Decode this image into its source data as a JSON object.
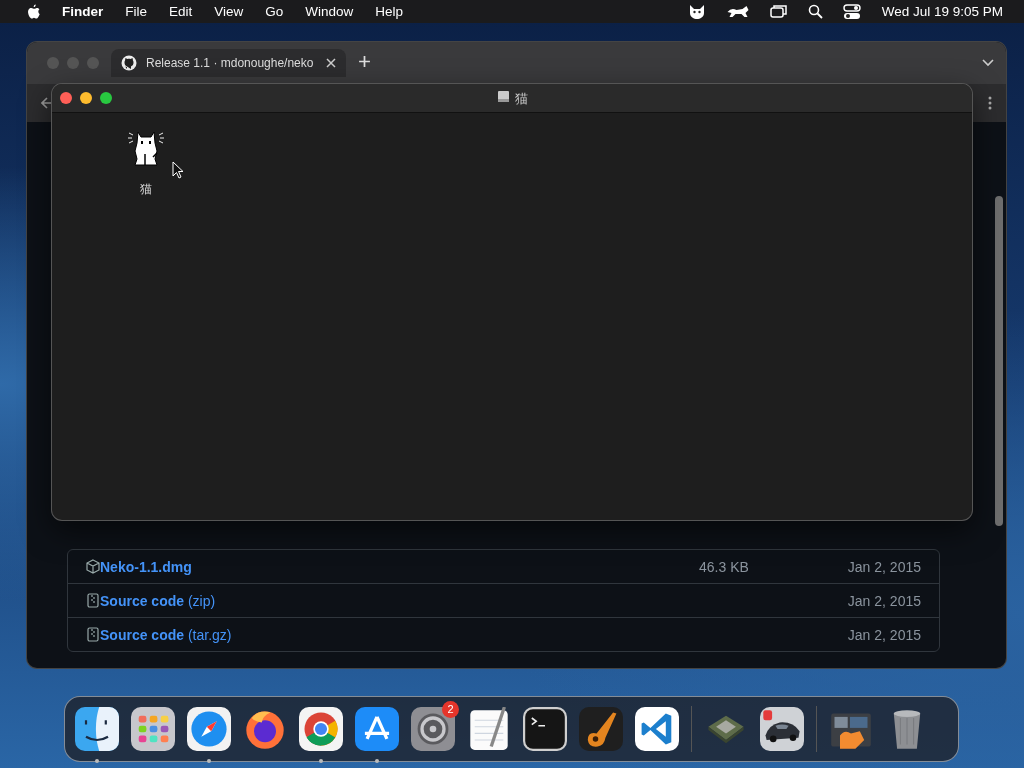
{
  "menu_bar": {
    "app": "Finder",
    "items": [
      "File",
      "Edit",
      "View",
      "Go",
      "Window",
      "Help"
    ],
    "clock": "Wed Jul 19  9:05 PM"
  },
  "browser": {
    "tab": {
      "title": "Release 1.1 · mdonoughe/neko",
      "selected": true
    },
    "assets": [
      {
        "name": "Neko-1.1.dmg",
        "kind": "package",
        "size": "46.3 KB",
        "date": "Jan 2, 2015"
      },
      {
        "name": "Source code",
        "suffix": "(zip)",
        "kind": "archive",
        "date": "Jan 2, 2015"
      },
      {
        "name": "Source code",
        "suffix": "(tar.gz)",
        "kind": "archive",
        "date": "Jan 2, 2015"
      }
    ]
  },
  "finder_window": {
    "title": "猫",
    "items": [
      {
        "label": "猫"
      }
    ]
  },
  "dock": [
    {
      "kind": "finder",
      "running": true
    },
    {
      "kind": "launchpad",
      "running": false
    },
    {
      "kind": "safari",
      "running": true
    },
    {
      "kind": "firefox",
      "running": false
    },
    {
      "kind": "chrome",
      "running": true
    },
    {
      "kind": "appstore",
      "running": true
    },
    {
      "kind": "settings",
      "running": false,
      "badge": "2"
    },
    {
      "kind": "textedit",
      "running": false
    },
    {
      "kind": "terminal",
      "running": false
    },
    {
      "kind": "guitar",
      "running": false
    },
    {
      "kind": "vscode",
      "running": false
    },
    {
      "kind": "separator"
    },
    {
      "kind": "chip",
      "running": false
    },
    {
      "kind": "car",
      "running": false
    },
    {
      "kind": "separator"
    },
    {
      "kind": "folder",
      "running": false
    },
    {
      "kind": "trash",
      "running": false
    }
  ]
}
